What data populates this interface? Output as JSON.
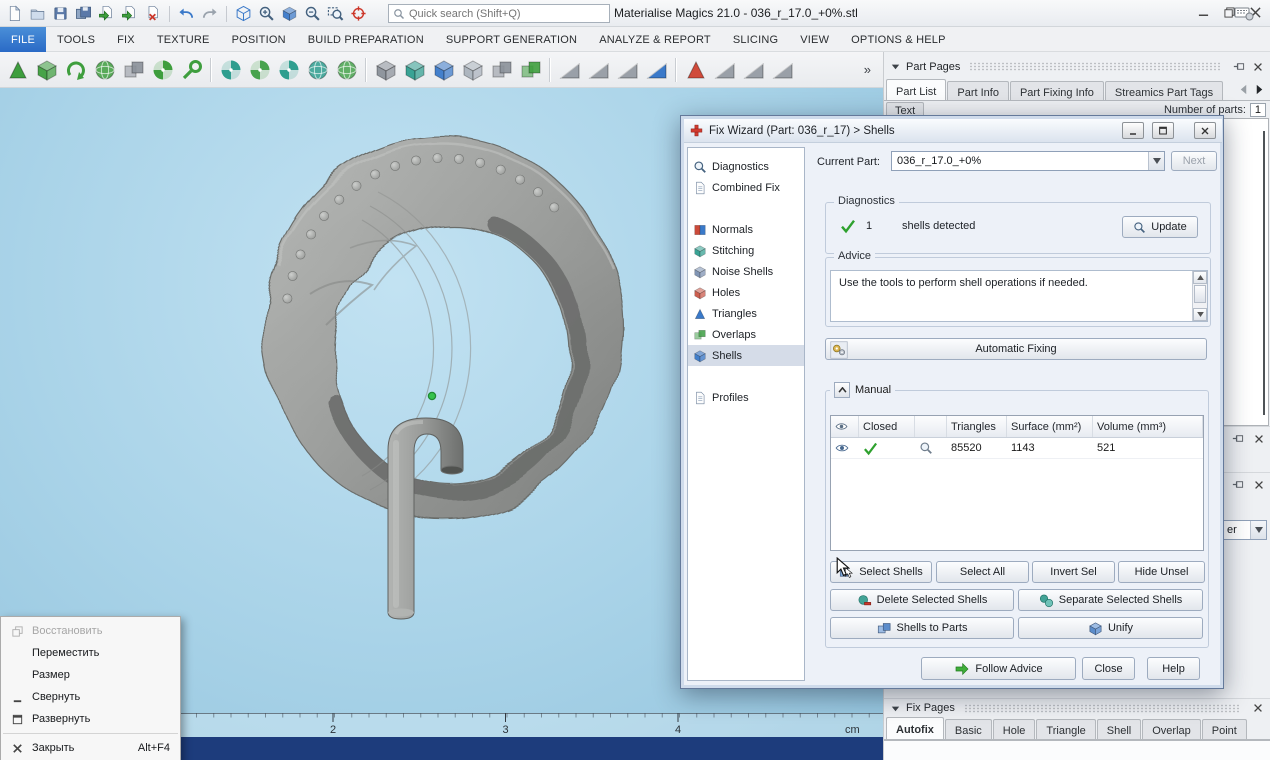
{
  "app": {
    "title": "Materialise Magics 21.0 - 036_r_17.0_+0%.stl",
    "search_placeholder": "Quick search (Shift+Q)",
    "accent_color": "#2a6ac6",
    "viewport_color": "#a9d3e8",
    "taskbar_color": "#1d3c7c",
    "success_green": "#2ea12e"
  },
  "titlebar_icons": [
    {
      "name": "new-file-icon",
      "shape": "page",
      "color": "#6b7f99"
    },
    {
      "name": "open-file-icon",
      "shape": "folder",
      "color": "#6b7f99"
    },
    {
      "name": "save-file-icon",
      "shape": "floppy",
      "color": "#5b79a8"
    },
    {
      "name": "save-all-icon",
      "shape": "floppy2",
      "color": "#5b79a8"
    },
    {
      "name": "import-file-icon",
      "shape": "pagearrow",
      "color": "#3e9e3e"
    },
    {
      "name": "export-file-icon",
      "shape": "pagearrow",
      "color": "#3e9e3e"
    },
    {
      "name": "close-part-icon",
      "shape": "pagex",
      "color": "#cc3629"
    },
    {
      "separator": true
    },
    {
      "name": "undo-icon",
      "shape": "undo",
      "color": "#3a79c9"
    },
    {
      "name": "redo-icon",
      "shape": "redo",
      "color": "#9aa3ad"
    },
    {
      "separator": true
    },
    {
      "name": "selection-cube-icon",
      "shape": "wirecube",
      "color": "#3a79c9"
    },
    {
      "name": "zoom-in-icon",
      "shape": "zoomin",
      "color": "#44617e"
    },
    {
      "name": "view-cube-icon",
      "shape": "cube",
      "color": "#3a79c9"
    },
    {
      "name": "zoom-out-icon",
      "shape": "zoomout",
      "color": "#44617e"
    },
    {
      "name": "zoom-window-icon",
      "shape": "zoomrect",
      "color": "#44617e"
    },
    {
      "name": "measure-icon",
      "shape": "target",
      "color": "#cc3629"
    }
  ],
  "menubar": {
    "items": [
      "FILE",
      "TOOLS",
      "FIX",
      "TEXTURE",
      "POSITION",
      "BUILD PREPARATION",
      "SUPPORT GENERATION",
      "ANALYZE & REPORT",
      "SLICING",
      "VIEW",
      "OPTIONS & HELP"
    ],
    "active_item": "FILE"
  },
  "toolbar": {
    "overflow_label": "»",
    "icons": [
      {
        "name": "import-part-icon",
        "shape": "tri",
        "color": "#3e9e3e"
      },
      {
        "name": "duplicate-part-icon",
        "shape": "cube",
        "color": "#3e9e3e"
      },
      {
        "name": "rotate-part-icon",
        "shape": "curvearrow",
        "color": "#3e9e3e"
      },
      {
        "name": "rescale-part-icon",
        "shape": "ball",
        "color": "#3e9e3e"
      },
      {
        "name": "mirror-part-icon",
        "shape": "square2",
        "color": "#8a9099"
      },
      {
        "name": "fix-part-icon",
        "shape": "fan",
        "color": "#3e9e3e"
      },
      {
        "name": "edit-part-icon",
        "shape": "wrench",
        "color": "#3e9e3e",
        "sep_after": true
      },
      {
        "name": "shell-select-icon",
        "shape": "fan",
        "color": "#2f9e8f"
      },
      {
        "name": "surface-select-icon",
        "shape": "fan",
        "color": "#48a34e"
      },
      {
        "name": "plane-select-icon",
        "shape": "fan",
        "color": "#2f9e8f"
      },
      {
        "name": "sphere-select-icon",
        "shape": "ball",
        "color": "#2f9e8f"
      },
      {
        "name": "globe-select-icon",
        "shape": "ball",
        "color": "#48a34e",
        "sep_after": true
      },
      {
        "name": "export-platform-icon",
        "shape": "cube",
        "color": "#8a9099"
      },
      {
        "name": "machine-cube-icon",
        "shape": "cube",
        "color": "#2f9e8f"
      },
      {
        "name": "build-cube-icon",
        "shape": "cube",
        "color": "#3a79c9"
      },
      {
        "name": "platform-cube-icon",
        "shape": "cube",
        "color": "#aab2bc"
      },
      {
        "name": "parts-group-icon",
        "shape": "square2",
        "color": "#8a9099"
      },
      {
        "name": "merge-parts-icon",
        "shape": "square2",
        "color": "#3e9e3e",
        "sep_after": true
      },
      {
        "name": "slice-view-icon",
        "shape": "ramp",
        "color": "#9aa0a8"
      },
      {
        "name": "slice-ramp-icon",
        "shape": "ramp",
        "color": "#9aa0a8"
      },
      {
        "name": "slice-stack-icon",
        "shape": "ramp",
        "color": "#9aa0a8"
      },
      {
        "name": "slice-blue-icon",
        "shape": "ramp",
        "color": "#3a79c9",
        "sep_after": true
      },
      {
        "name": "support-generation-icon",
        "shape": "tri",
        "color": "#d04a3a"
      },
      {
        "name": "support-ramp-icon",
        "shape": "ramp",
        "color": "#9aa0a8"
      },
      {
        "name": "support-ramp2-icon",
        "shape": "ramp",
        "color": "#9aa0a8"
      },
      {
        "name": "support-ramp3-icon",
        "shape": "ramp",
        "color": "#9aa0a8"
      }
    ]
  },
  "part_pages": {
    "title": "Part Pages",
    "tabs": [
      "Part List",
      "Part Info",
      "Part Fixing Info",
      "Streamics Part Tags"
    ],
    "second_row_tab": "Text",
    "active_tab": "Part List",
    "number_of_parts_label": "Number of parts:",
    "number_of_parts_value": "1"
  },
  "hidden_panels": {
    "dropdown_value": "er"
  },
  "fix_pages": {
    "title": "Fix Pages",
    "tabs": [
      "Autofix",
      "Basic",
      "Hole",
      "Triangle",
      "Shell",
      "Overlap",
      "Point"
    ],
    "active_tab": "Autofix"
  },
  "viewport": {
    "ruler_labels": [
      "2",
      "3",
      "4"
    ],
    "ruler_unit": "cm"
  },
  "system_menu": {
    "items": [
      {
        "label": "Восстановить",
        "key": "restore",
        "icon": "restore",
        "shortcut": "",
        "disabled": true
      },
      {
        "label": "Переместить",
        "key": "move",
        "shortcut": ""
      },
      {
        "label": "Размер",
        "key": "size",
        "shortcut": ""
      },
      {
        "label": "Свернуть",
        "key": "minimize",
        "icon": "minimize",
        "shortcut": ""
      },
      {
        "label": "Развернуть",
        "key": "maximize",
        "icon": "maximize",
        "shortcut": "",
        "separator_after": true
      },
      {
        "label": "Закрыть",
        "key": "close",
        "icon": "close",
        "shortcut": "Alt+F4"
      }
    ]
  },
  "fix_wizard": {
    "title": "Fix Wizard (Part: 036_r_17) > Shells",
    "active_sidebar_item": "Shells",
    "sidebar_items": [
      {
        "label": "Diagnostics",
        "shape": "magnifier",
        "color": "#44617e"
      },
      {
        "label": "Combined Fix",
        "shape": "pagelines",
        "color": "#6b7f99"
      },
      {
        "label": "Normals",
        "shape": "halfsq",
        "color": "#cc4a3a",
        "spacer_before": true
      },
      {
        "label": "Stitching",
        "shape": "cube",
        "color": "#2f9e8f"
      },
      {
        "label": "Noise Shells",
        "shape": "cube",
        "color": "#7a8fb0"
      },
      {
        "label": "Holes",
        "shape": "cube",
        "color": "#c95545"
      },
      {
        "label": "Triangles",
        "shape": "tri",
        "color": "#3a79c9"
      },
      {
        "label": "Overlaps",
        "shape": "square2",
        "color": "#48a34e"
      },
      {
        "label": "Shells",
        "shape": "cube",
        "color": "#3a79c9"
      },
      {
        "label": "Profiles",
        "shape": "pagelines",
        "color": "#6b7f99",
        "spacer_before": true
      }
    ],
    "current_part": {
      "label": "Current Part:",
      "value": "036_r_17.0_+0%",
      "next_label": "Next"
    },
    "diagnostics": {
      "group_title": "Diagnostics",
      "count": "1",
      "message": "shells detected",
      "update_label": "Update"
    },
    "advice": {
      "group_title": "Advice",
      "message": "Use the tools to perform shell operations if needed."
    },
    "automatic_fixing_label": "Automatic Fixing",
    "manual": {
      "group_title": "Manual",
      "table": {
        "closed_header": "Closed",
        "triangles_header": "Triangles",
        "surface_header": "Surface (mm²)",
        "volume_header": "Volume (mm³)",
        "row": {
          "closed": true,
          "triangles": "85520",
          "surface": "1143",
          "volume": "521"
        }
      },
      "select_shells": "Select Shells",
      "select_all": "Select All",
      "invert_sel": "Invert Sel",
      "hide_unsel": "Hide Unsel",
      "delete_selected": "Delete Selected Shells",
      "separate_selected": "Separate Selected Shells",
      "shells_to_parts": "Shells to Parts",
      "unify": "Unify"
    },
    "footer": {
      "follow_advice": "Follow Advice",
      "close": "Close",
      "help": "Help"
    }
  }
}
